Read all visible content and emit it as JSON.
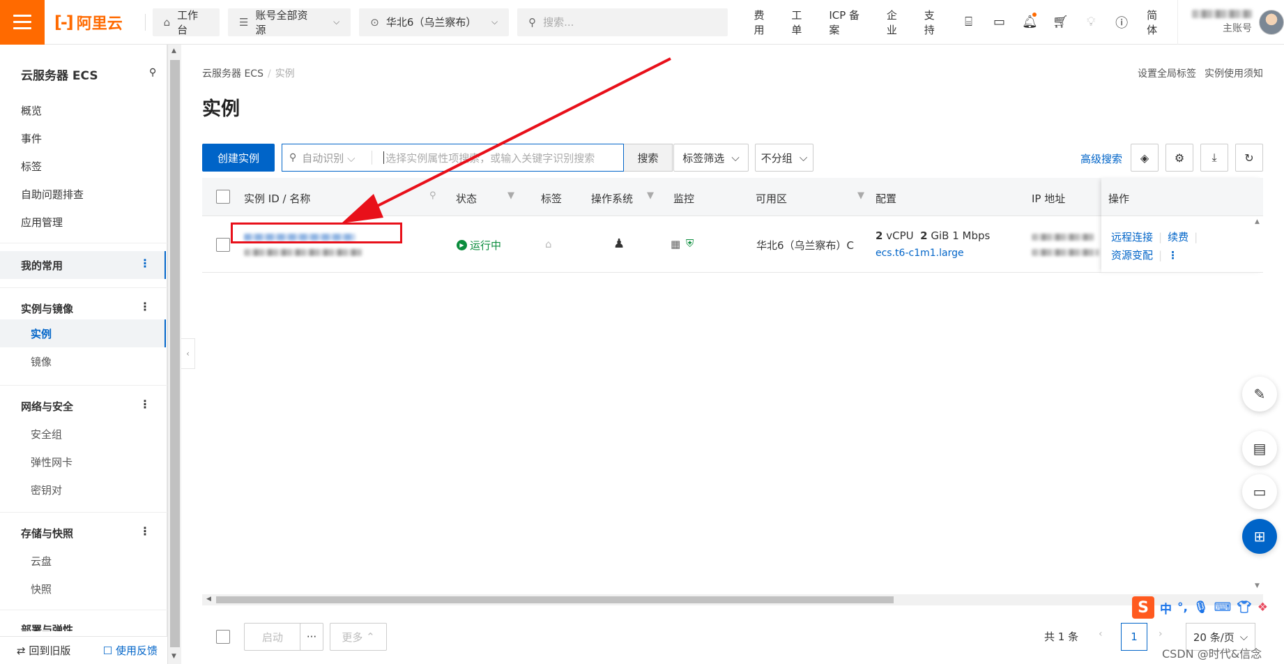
{
  "topbar": {
    "logo_text": "阿里云",
    "workbench": "工作台",
    "resources": "账号全部资源",
    "region": "华北6（乌兰察布）",
    "search_placeholder": "搜索...",
    "links": [
      "费用",
      "工单",
      "ICP 备案",
      "企业",
      "支持"
    ],
    "lang": "简体",
    "account_label": "主账号"
  },
  "sidebar": {
    "title": "云服务器 ECS",
    "top_items": [
      "概览",
      "事件",
      "标签",
      "自助问题排查",
      "应用管理"
    ],
    "favorites": "我的常用",
    "group_instances": "实例与镜像",
    "instances_items": [
      "实例",
      "镜像"
    ],
    "group_network": "网络与安全",
    "network_items": [
      "安全组",
      "弹性网卡",
      "密钥对"
    ],
    "group_storage": "存储与快照",
    "storage_items": [
      "云盘",
      "快照"
    ],
    "group_deploy": "部署与弹性",
    "footer_back": "回到旧版",
    "footer_feedback": "使用反馈"
  },
  "breadcrumb": {
    "root": "云服务器 ECS",
    "current": "实例"
  },
  "header_links": [
    "设置全局标签",
    "实例使用须知"
  ],
  "page_title": "实例",
  "toolbar": {
    "create": "创建实例",
    "search_mode": "自动识别",
    "search_placeholder": "选择实例属性项搜索，或输入关键字识别搜索",
    "search_btn": "搜索",
    "tag_filter": "标签筛选",
    "group": "不分组",
    "advanced": "高级搜索"
  },
  "table": {
    "headers": [
      "实例 ID / 名称",
      "状态",
      "标签",
      "操作系统",
      "监控",
      "可用区",
      "配置",
      "IP 地址",
      "操作"
    ],
    "row": {
      "status": "运行中",
      "zone": "华北6（乌兰察布）C",
      "config_vcpu_num": "2",
      "config_vcpu": "vCPU",
      "config_mem_num": "2",
      "config_mem": "GiB 1 Mbps",
      "instance_type": "ecs.t6-c1m1.large",
      "op_remote": "远程连接",
      "op_renew": "续费",
      "op_change": "资源变配"
    }
  },
  "bottom": {
    "start": "启动",
    "more_dots": "···",
    "more": "更多",
    "total": "共 1 条",
    "page": "1",
    "page_size": "20 条/页"
  },
  "ime": {
    "zh": "中"
  },
  "watermark": "CSDN @时代&信念",
  "colors": {
    "brand": "#ff6a00",
    "primary": "#0064c8",
    "running": "#0a8c3c",
    "annotation": "#e8101a"
  }
}
